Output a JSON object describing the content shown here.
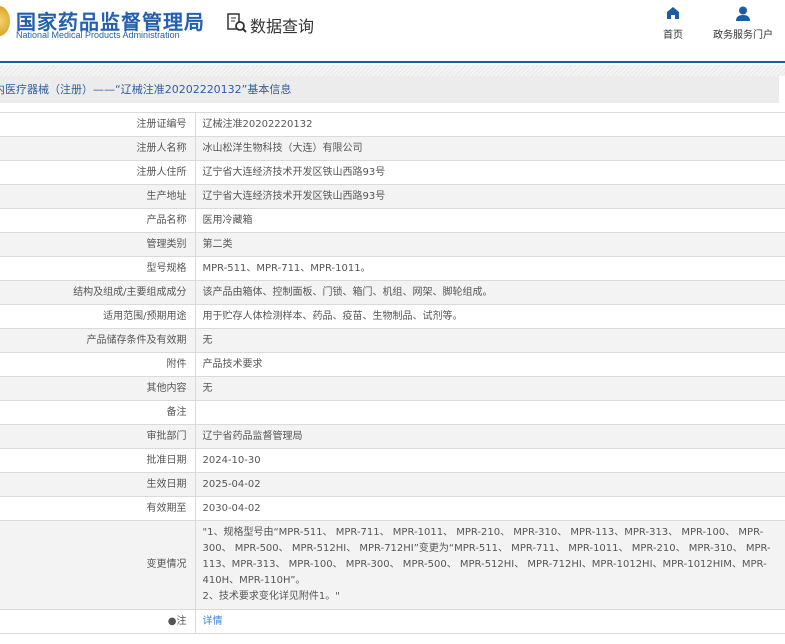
{
  "header": {
    "logo_cn": "国家药品监督管理局",
    "logo_en": "National Medical Products Administration",
    "query": "数据查询",
    "nav": [
      {
        "label": "首页",
        "icon": "home-icon"
      },
      {
        "label": "政务服务门户",
        "icon": "user-icon"
      }
    ]
  },
  "band": {
    "title": "内医疗器械（注册）——“辽械注准20202220132”基本信息"
  },
  "rows": [
    {
      "label": "注册证编号",
      "value": "辽械注准20202220132"
    },
    {
      "label": "注册人名称",
      "value": "冰山松洋生物科技（大连）有限公司"
    },
    {
      "label": "注册人住所",
      "value": "辽宁省大连经济技术开发区铁山西路93号"
    },
    {
      "label": "生产地址",
      "value": "辽宁省大连经济技术开发区铁山西路93号"
    },
    {
      "label": "产品名称",
      "value": "医用冷藏箱"
    },
    {
      "label": "管理类别",
      "value": "第二类"
    },
    {
      "label": "型号规格",
      "value": "MPR-511、MPR-711、MPR-1011。"
    },
    {
      "label": "结构及组成/主要组成成分",
      "value": "该产品由箱体、控制面板、门锁、箱门、机组、网架、脚轮组成。"
    },
    {
      "label": "适用范围/预期用途",
      "value": "用于贮存人体检测样本、药品、疫苗、生物制品、试剂等。"
    },
    {
      "label": "产品储存条件及有效期",
      "value": "无"
    },
    {
      "label": "附件",
      "value": "产品技术要求"
    },
    {
      "label": "其他内容",
      "value": "无"
    },
    {
      "label": "备注",
      "value": ""
    },
    {
      "label": "审批部门",
      "value": "辽宁省药品监督管理局"
    },
    {
      "label": "批准日期",
      "value": "2024-10-30"
    },
    {
      "label": "生效日期",
      "value": "2025-04-02"
    },
    {
      "label": "有效期至",
      "value": "2030-04-02"
    },
    {
      "label": "变更情况",
      "value": "\"1、规格型号由“MPR-511、 MPR-711、 MPR-1011、 MPR-210、 MPR-310、 MPR-113、MPR-313、 MPR-100、 MPR-300、 MPR-500、 MPR-512HI、 MPR-712HI”变更为“MPR-511、 MPR-711、 MPR-1011、 MPR-210、 MPR-310、 MPR-113、MPR-313、 MPR-100、 MPR-300、 MPR-500、 MPR-512HI、 MPR-712HI、MPR-1012HI、MPR-1012HIM、MPR-410H、MPR-110H”。",
      "value2": "2、技术要求变化详见附件1。\""
    },
    {
      "label": "●注",
      "value": "详情"
    }
  ]
}
